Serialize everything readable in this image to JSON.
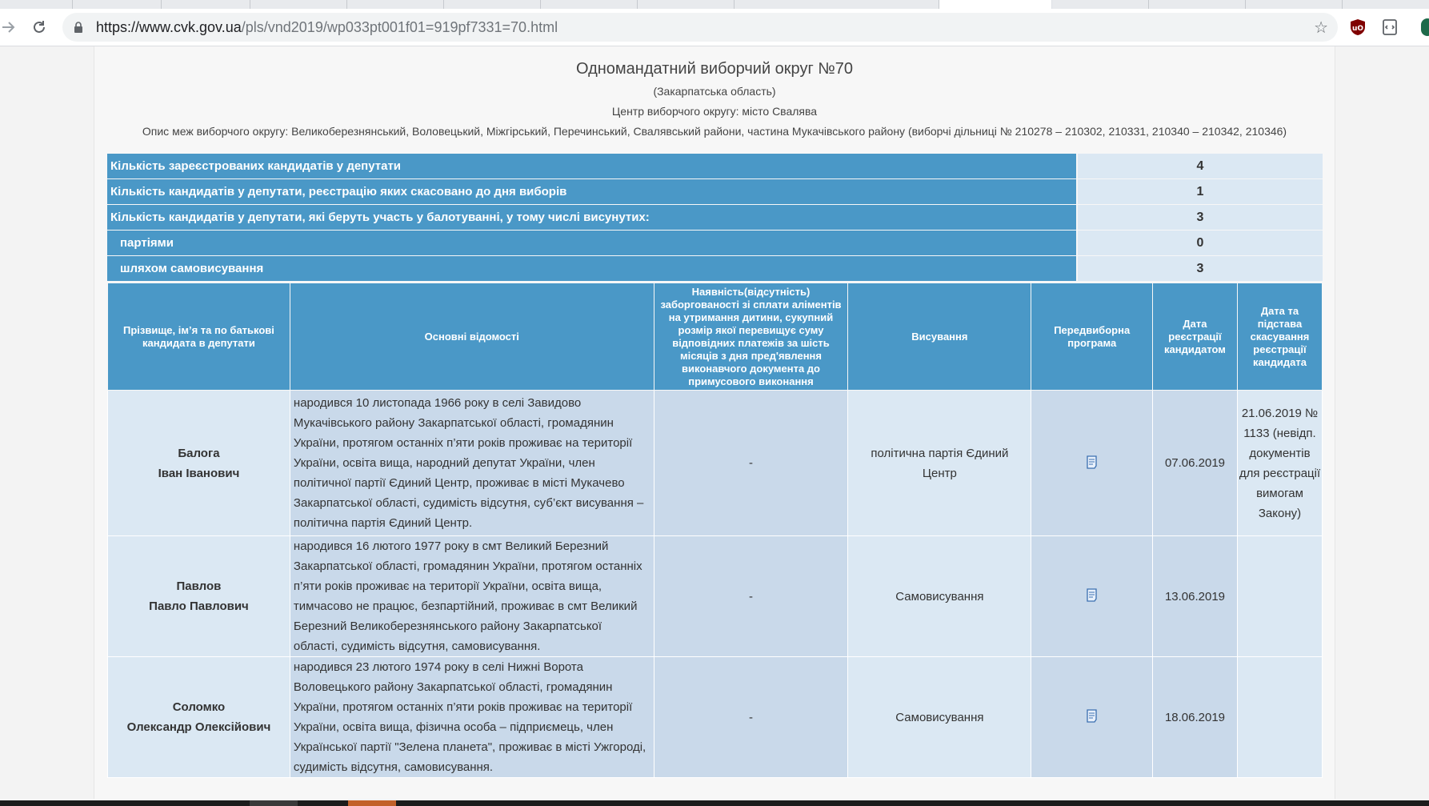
{
  "browser": {
    "url_host": "https://www.cvk.gov.ua",
    "url_path": "/pls/vnd2019/wp033pt001f01=919pf7331=70.html"
  },
  "header": {
    "title": "Одномандатний виборчий округ №70",
    "region": "(Закарпатська область)",
    "center": "Центр виборчого округу: місто Свалява",
    "description": "Опис меж виборчого округу: Великоберезнянський, Воловецький, Міжгірський, Перечинський, Свалявський райони, частина Мукачівського району (виборчі дільниці № 210278 – 210302, 210331, 210340 – 210342, 210346)"
  },
  "stats": [
    {
      "label": "Кількість зареєстрованих кандидатів у депутати",
      "value": "4"
    },
    {
      "label": "Кількість кандидатів у депутати, реєстрацію яких скасовано до дня виборів",
      "value": "1"
    },
    {
      "label": "Кількість кандидатів у депутати, які беруть участь у балотуванні, у тому числі висунутих:",
      "value": "3"
    },
    {
      "label": "партіями",
      "value": "0"
    },
    {
      "label": "шляхом самовисування",
      "value": "3"
    }
  ],
  "table": {
    "headers": [
      "Прізвище, ім’я та по батькові кандидата в депутати",
      "Основні відомості",
      "Наявність(відсутність) заборгованості зі сплати аліментів на утримання дитини, сукупний розмір якої перевищує суму відповідних платежів за шість місяців з дня пред'явлення виконавчого документа до примусового виконання",
      "Висування",
      "Передвиборна програма",
      "Дата реєстрації кандидатом",
      "Дата та підстава скасування реєстрації кандидата"
    ],
    "rows": [
      {
        "surname": "Балога",
        "given": "Іван Іванович",
        "info": "народився 10 листопада 1966 року в селі Завидово Мукачівського району Закарпатської області, громадянин України, протягом останніх п’яти років проживає на території України, освіта вища, народний депутат України, член політичної партії Єдиний Центр, проживає в місті Мукачево Закарпатської області, судимість відсутня, суб’єкт висування – політична партія Єдиний Центр.",
        "debt": "-",
        "nomination": "політична партія Єдиний Центр",
        "date": "07.06.2019",
        "cancel": "21.06.2019 № 1133 (невідп. документів для реєстрації вимогам Закону)"
      },
      {
        "surname": "Павлов",
        "given": "Павло Павлович",
        "info": "народився 16 лютого 1977 року в смт Великий Березний Закарпатської області, громадянин України, протягом останніх п’яти років проживає на території України, освіта вища, тимчасово не працює, безпартійний, проживає в смт Великий Березний Великоберезнянського району Закарпатської області, судимість відсутня, самовисування.",
        "debt": "-",
        "nomination": "Самовисування",
        "date": "13.06.2019",
        "cancel": ""
      },
      {
        "surname": "Соломко",
        "given": "Олександр Олексійович",
        "info": "народився 23 лютого 1974 року в селі Нижні Ворота Воловецького району Закарпатської області, громадянин України, протягом останніх п’яти років проживає на території України, освіта вища, фізична особа – підприємець, член Української партії \"Зелена планета\", проживає в місті Ужгороді, судимість відсутня, самовисування.",
        "debt": "-",
        "nomination": "Самовисування",
        "date": "18.06.2019",
        "cancel": ""
      }
    ]
  }
}
